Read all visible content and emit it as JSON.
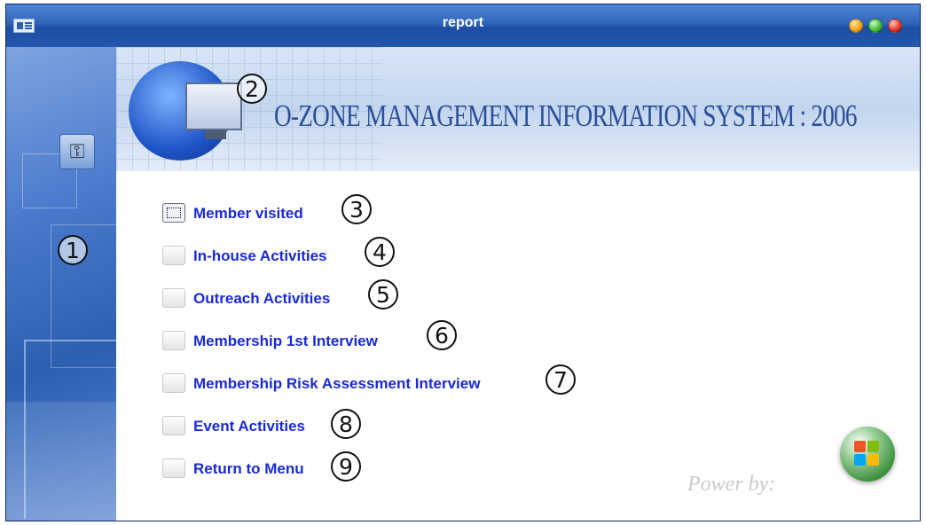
{
  "window": {
    "title": "report"
  },
  "banner": {
    "title": "O-ZONE MANAGEMENT INFORMATION SYSTEM : 2006"
  },
  "menu": {
    "items": [
      {
        "label": "Member visited",
        "callout": "3"
      },
      {
        "label": "In-house Activities",
        "callout": "4"
      },
      {
        "label": "Outreach Activities",
        "callout": "5"
      },
      {
        "label": "Membership 1st Interview",
        "callout": "6"
      },
      {
        "label": "Membership Risk Assessment Interview",
        "callout": "7"
      },
      {
        "label": "Event Activities",
        "callout": "8"
      },
      {
        "label": "Return to Menu",
        "callout": "9"
      }
    ]
  },
  "callouts": {
    "left_panel": "1",
    "banner": "2"
  },
  "footer": {
    "power_text": "Power by:"
  },
  "colors": {
    "titlebar": "#2f65b9",
    "menu_text": "#1a2ad6",
    "banner_text": "#2a4f9a"
  }
}
